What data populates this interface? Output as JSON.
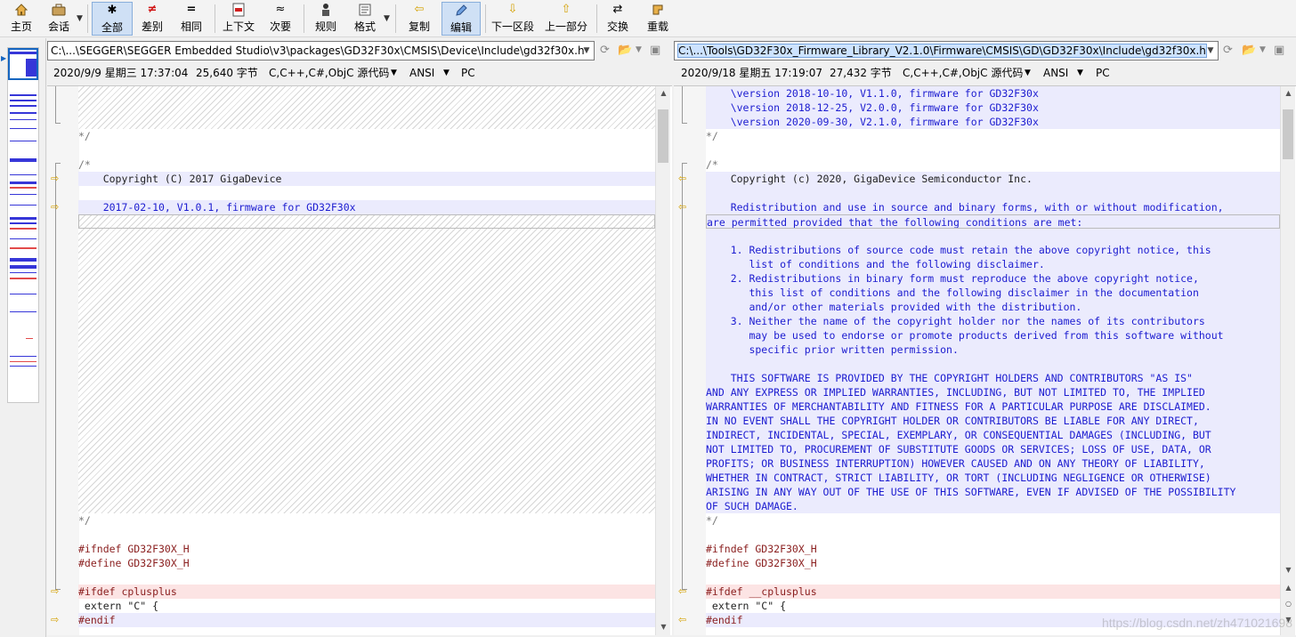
{
  "toolbar": {
    "home": "主页",
    "session": "会话",
    "all": "全部",
    "diffs": "差别",
    "same": "相同",
    "context": "上下文",
    "minor": "次要",
    "rules": "规则",
    "format": "格式",
    "copy": "复制",
    "edit": "编辑",
    "next_section": "下一区段",
    "prev_section": "上一部分",
    "swap": "交换",
    "reload": "重载"
  },
  "left": {
    "path": "C:\\...\\SEGGER\\SEGGER Embedded Studio\\v3\\packages\\GD32F30x\\CMSIS\\Device\\Include\\gd32f30x.h",
    "date": "2020/9/9 星期三 17:37:04",
    "size": "25,640 字节",
    "format": "C,C++,C#,ObjC 源代码",
    "encoding": "ANSI",
    "lineend": "PC",
    "lines": {
      "l_close1": "*/",
      "l_open": "/*",
      "l_copyright": "    Copyright (C) 2017 GigaDevice",
      "l_ver": "    2017-02-10, V1.0.1, firmware for GD32F30x",
      "l_close2": "*/",
      "l_ifndef": "#ifndef GD32F30X_H",
      "l_define": "#define GD32F30X_H",
      "l_ifdef": "#ifdef cplusplus",
      "l_extern": " extern \"C\" {",
      "l_endif": "#endif"
    }
  },
  "right": {
    "path": "C:\\...\\Tools\\GD32F30x_Firmware_Library_V2.1.0\\Firmware\\CMSIS\\GD\\GD32F30x\\Include\\gd32f30x.h",
    "date": "2020/9/18 星期五 17:19:07",
    "size": "27,432 字节",
    "format": "C,C++,C#,ObjC 源代码",
    "encoding": "ANSI",
    "lineend": "PC",
    "lines": {
      "r_v110": "    \\version 2018-10-10, V1.1.0, firmware for GD32F30x",
      "r_v200": "    \\version 2018-12-25, V2.0.0, firmware for GD32F30x",
      "r_v210": "    \\version 2020-09-30, V2.1.0, firmware for GD32F30x",
      "r_close1": "*/",
      "r_open": "/*",
      "r_copyright": "    Copyright (c) 2020, GigaDevice Semiconductor Inc.",
      "r_redis1": "    Redistribution and use in source and binary forms, with or without modification,",
      "r_redis2": "are permitted provided that the following conditions are met:",
      "r_c1a": "    1. Redistributions of source code must retain the above copyright notice, this",
      "r_c1b": "       list of conditions and the following disclaimer.",
      "r_c2a": "    2. Redistributions in binary form must reproduce the above copyright notice,",
      "r_c2b": "       this list of conditions and the following disclaimer in the documentation",
      "r_c2c": "       and/or other materials provided with the distribution.",
      "r_c3a": "    3. Neither the name of the copyright holder nor the names of its contributors",
      "r_c3b": "       may be used to endorse or promote products derived from this software without",
      "r_c3c": "       specific prior written permission.",
      "r_w1": "    THIS SOFTWARE IS PROVIDED BY THE COPYRIGHT HOLDERS AND CONTRIBUTORS \"AS IS\"",
      "r_w2": "AND ANY EXPRESS OR IMPLIED WARRANTIES, INCLUDING, BUT NOT LIMITED TO, THE IMPLIED",
      "r_w3": "WARRANTIES OF MERCHANTABILITY AND FITNESS FOR A PARTICULAR PURPOSE ARE DISCLAIMED.",
      "r_w4": "IN NO EVENT SHALL THE COPYRIGHT HOLDER OR CONTRIBUTORS BE LIABLE FOR ANY DIRECT,",
      "r_w5": "INDIRECT, INCIDENTAL, SPECIAL, EXEMPLARY, OR CONSEQUENTIAL DAMAGES (INCLUDING, BUT",
      "r_w6": "NOT LIMITED TO, PROCUREMENT OF SUBSTITUTE GOODS OR SERVICES; LOSS OF USE, DATA, OR",
      "r_w7": "PROFITS; OR BUSINESS INTERRUPTION) HOWEVER CAUSED AND ON ANY THEORY OF LIABILITY,",
      "r_w8": "WHETHER IN CONTRACT, STRICT LIABILITY, OR TORT (INCLUDING NEGLIGENCE OR OTHERWISE)",
      "r_w9": "ARISING IN ANY WAY OUT OF THE USE OF THIS SOFTWARE, EVEN IF ADVISED OF THE POSSIBILITY",
      "r_w10": "OF SUCH DAMAGE.",
      "r_close2": "*/",
      "r_ifndef": "#ifndef GD32F30X_H",
      "r_define": "#define GD32F30X_H",
      "r_ifdef": "#ifdef __cplusplus",
      "r_extern": " extern \"C\" {",
      "r_endif": "#endif"
    }
  },
  "watermark": "https://blog.csdn.net/zh471021698"
}
